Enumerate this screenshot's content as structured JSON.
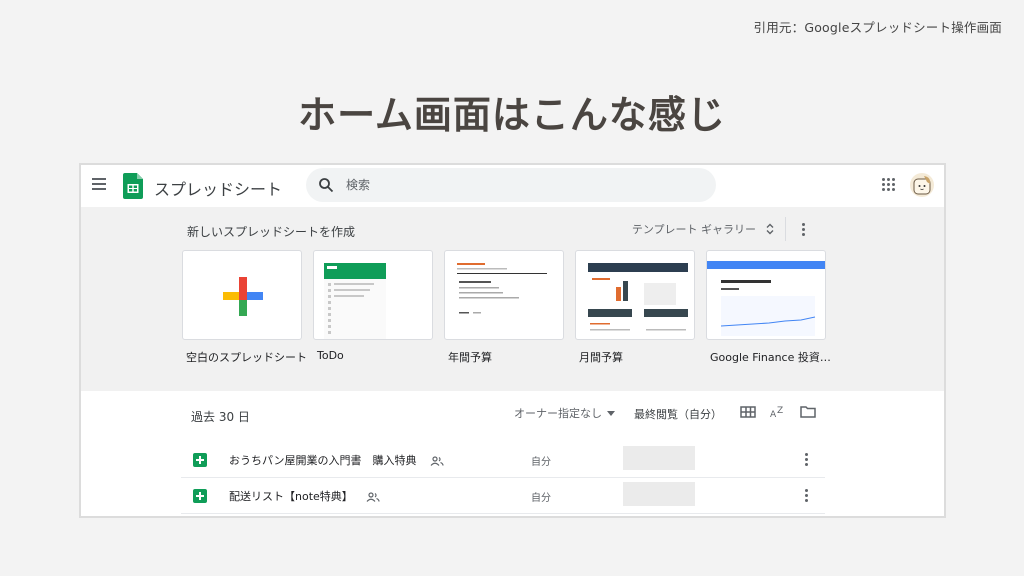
{
  "credit": "引用元：Googleスプレッドシート操作画面",
  "headline": "ホーム画面はこんな感じ",
  "topbar": {
    "app_title": "スプレッドシート",
    "search_placeholder": "検索"
  },
  "templates": {
    "heading": "新しいスプレッドシートを作成",
    "gallery_label": "テンプレート ギャラリー",
    "cards": [
      {
        "label": "空白のスプレッドシート"
      },
      {
        "label": "ToDo"
      },
      {
        "label": "年間予算"
      },
      {
        "label": "月間予算"
      },
      {
        "label": "Google Finance 投資…"
      }
    ]
  },
  "files": {
    "section_title": "過去 30 日",
    "owner_filter": "オーナー指定なし",
    "sort_label": "最終閲覧（自分）",
    "rows": [
      {
        "name": "おうちパン屋開業の入門書　購入特典",
        "owner": "自分"
      },
      {
        "name": "配送リスト【note特典】",
        "owner": "自分"
      }
    ]
  },
  "colors": {
    "sheets_green": "#0f9d58",
    "google_red": "#ea4335",
    "google_blue": "#4285f4",
    "google_yellow": "#fbbc04",
    "google_green": "#34a853"
  }
}
